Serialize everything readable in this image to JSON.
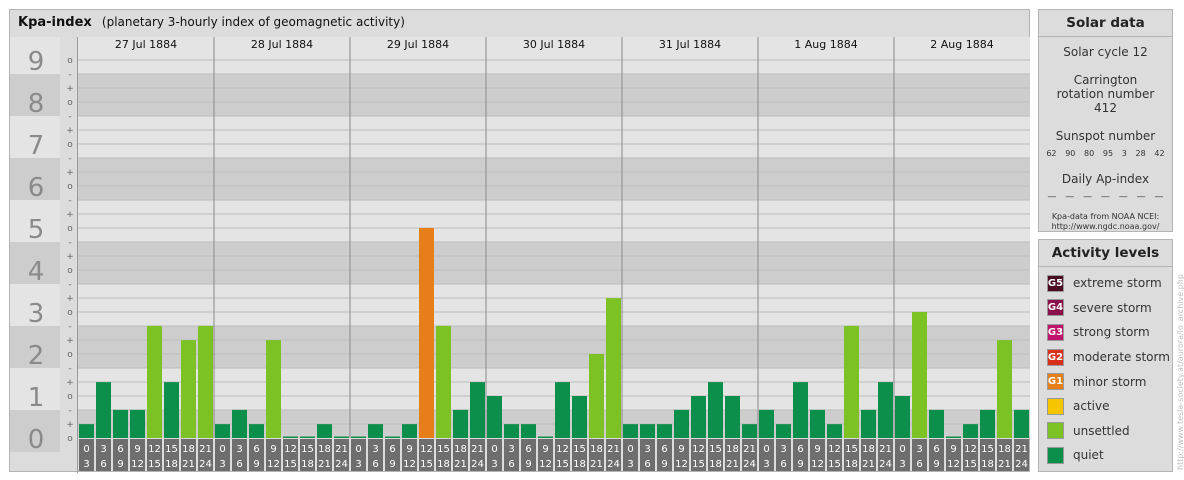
{
  "header": {
    "title": "Kpa-index",
    "subtitle": "(planetary 3-hourly index of geomagnetic activity)"
  },
  "chart_data": {
    "type": "bar",
    "title": "Kpa-index",
    "subtitle": "(planetary 3-hourly index of geomagnetic activity)",
    "ylim": [
      0,
      9
    ],
    "y_ticks": [
      "0",
      "1",
      "2",
      "3",
      "4",
      "5",
      "6",
      "7",
      "8",
      "9"
    ],
    "minor_ticks": [
      "o",
      "+",
      "-"
    ],
    "days": [
      "27 Jul 1884",
      "28 Jul 1884",
      "29 Jul 1884",
      "30 Jul 1884",
      "31 Jul 1884",
      "1 Aug 1884",
      "2 Aug 1884"
    ],
    "interval_labels": [
      [
        "0",
        "3"
      ],
      [
        "3",
        "6"
      ],
      [
        "6",
        "9"
      ],
      [
        "9",
        "12"
      ],
      [
        "12",
        "15"
      ],
      [
        "15",
        "18"
      ],
      [
        "18",
        "21"
      ],
      [
        "21",
        "24"
      ]
    ],
    "values": [
      [
        0.33,
        1.33,
        0.67,
        0.67,
        2.67,
        1.33,
        2.33,
        2.67
      ],
      [
        0.33,
        0.67,
        0.33,
        2.33,
        0,
        0,
        0.33,
        0
      ],
      [
        0,
        0.33,
        0,
        0.33,
        5,
        2.67,
        0.67,
        1.33
      ],
      [
        1,
        0.33,
        0.33,
        0,
        1.33,
        1,
        2,
        3.33
      ],
      [
        0.33,
        0.33,
        0.33,
        0.67,
        1,
        1.33,
        1,
        0.33
      ],
      [
        0.67,
        0.33,
        1.33,
        0.67,
        0.33,
        2.67,
        0.67,
        1.33
      ],
      [
        1,
        3,
        0.67,
        0,
        0.33,
        0.67,
        2.33,
        0.67
      ]
    ],
    "level_colors": {
      "quiet": "#0b8f4a",
      "unsettled": "#7cc225",
      "active": "#f6c500",
      "minor storm": "#e67e1a"
    },
    "grid": true
  },
  "solar": {
    "title": "Solar data",
    "cycle": "Solar cycle 12",
    "carrington": "Carrington rotation number 412",
    "sunspot_label": "Sunspot number",
    "sunspots": [
      "62",
      "90",
      "80",
      "95",
      "3",
      "28",
      "42"
    ],
    "ap_label": "Daily Ap-index",
    "ap_values": [
      "—",
      "—",
      "—",
      "—",
      "—",
      "—",
      "—"
    ],
    "source_line1": "Kpa-data from NOAA NCEI:",
    "source_line2": "http://www.ngdc.noaa.gov/"
  },
  "levels": {
    "title": "Activity levels",
    "items": [
      {
        "badge": "G5",
        "label": "extreme storm",
        "color": "#4a0a22"
      },
      {
        "badge": "G4",
        "label": "severe storm",
        "color": "#8a0f4a"
      },
      {
        "badge": "G3",
        "label": "strong storm",
        "color": "#c0136c"
      },
      {
        "badge": "G2",
        "label": "moderate storm",
        "color": "#d9301c"
      },
      {
        "badge": "G1",
        "label": "minor storm",
        "color": "#e67e1a"
      },
      {
        "badge": "",
        "label": "active",
        "color": "#f6c500"
      },
      {
        "badge": "",
        "label": "unsettled",
        "color": "#7cc225"
      },
      {
        "badge": "",
        "label": "quiet",
        "color": "#0b8f4a"
      }
    ]
  },
  "watermark": "http://www.tesla-society.at/aurora/lo_archive.php"
}
